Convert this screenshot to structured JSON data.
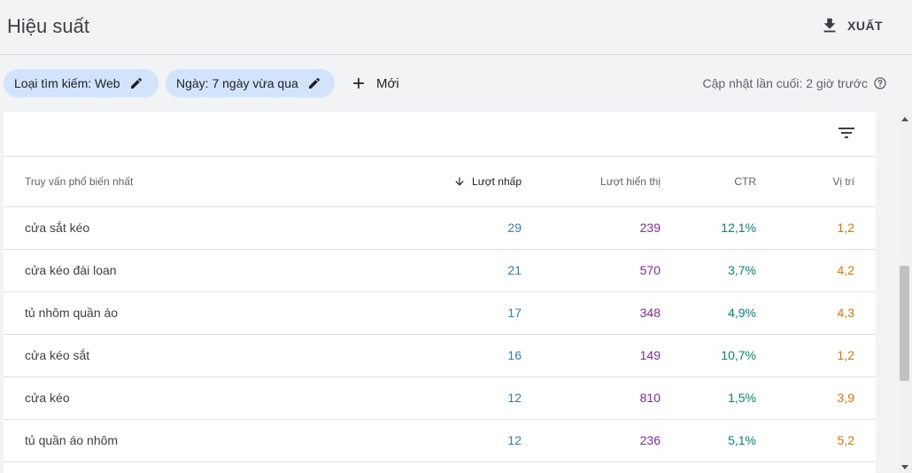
{
  "header": {
    "title": "Hiệu suất",
    "export_label": "XUẤT"
  },
  "filters": {
    "chips": [
      {
        "label": "Loại tìm kiếm: Web"
      },
      {
        "label": "Ngày: 7 ngày vừa qua"
      }
    ],
    "new_label": "Mới",
    "last_update": "Cập nhật lần cuối: 2 giờ trước"
  },
  "table": {
    "columns": {
      "query": "Truy vấn phổ biến nhất",
      "clicks": "Lượt nhấp",
      "impressions": "Lượt hiển thị",
      "ctr": "CTR",
      "position": "Vị trí"
    },
    "rows": [
      {
        "query": "cửa sắt kéo",
        "clicks": "29",
        "impressions": "239",
        "ctr": "12,1%",
        "position": "1,2"
      },
      {
        "query": "cửa kéo đài loan",
        "clicks": "21",
        "impressions": "570",
        "ctr": "3,7%",
        "position": "4,2"
      },
      {
        "query": "tủ nhôm quần áo",
        "clicks": "17",
        "impressions": "348",
        "ctr": "4,9%",
        "position": "4,3"
      },
      {
        "query": "cửa kéo sắt",
        "clicks": "16",
        "impressions": "149",
        "ctr": "10,7%",
        "position": "1,2"
      },
      {
        "query": "cửa kéo",
        "clicks": "12",
        "impressions": "810",
        "ctr": "1,5%",
        "position": "3,9"
      },
      {
        "query": "tủ quần áo nhôm",
        "clicks": "12",
        "impressions": "236",
        "ctr": "5,1%",
        "position": "5,2"
      }
    ]
  },
  "icons": {
    "export": "download-icon",
    "edit": "pencil-icon",
    "new": "plus-icon",
    "help": "help-circle-icon",
    "filter": "filter-icon",
    "sort": "arrow-down-icon"
  },
  "colors": {
    "chip_bg": "#d2e3fc",
    "clicks": "#2e7bcf",
    "impressions": "#8e24aa",
    "ctr": "#00897b",
    "position": "#e37400"
  }
}
